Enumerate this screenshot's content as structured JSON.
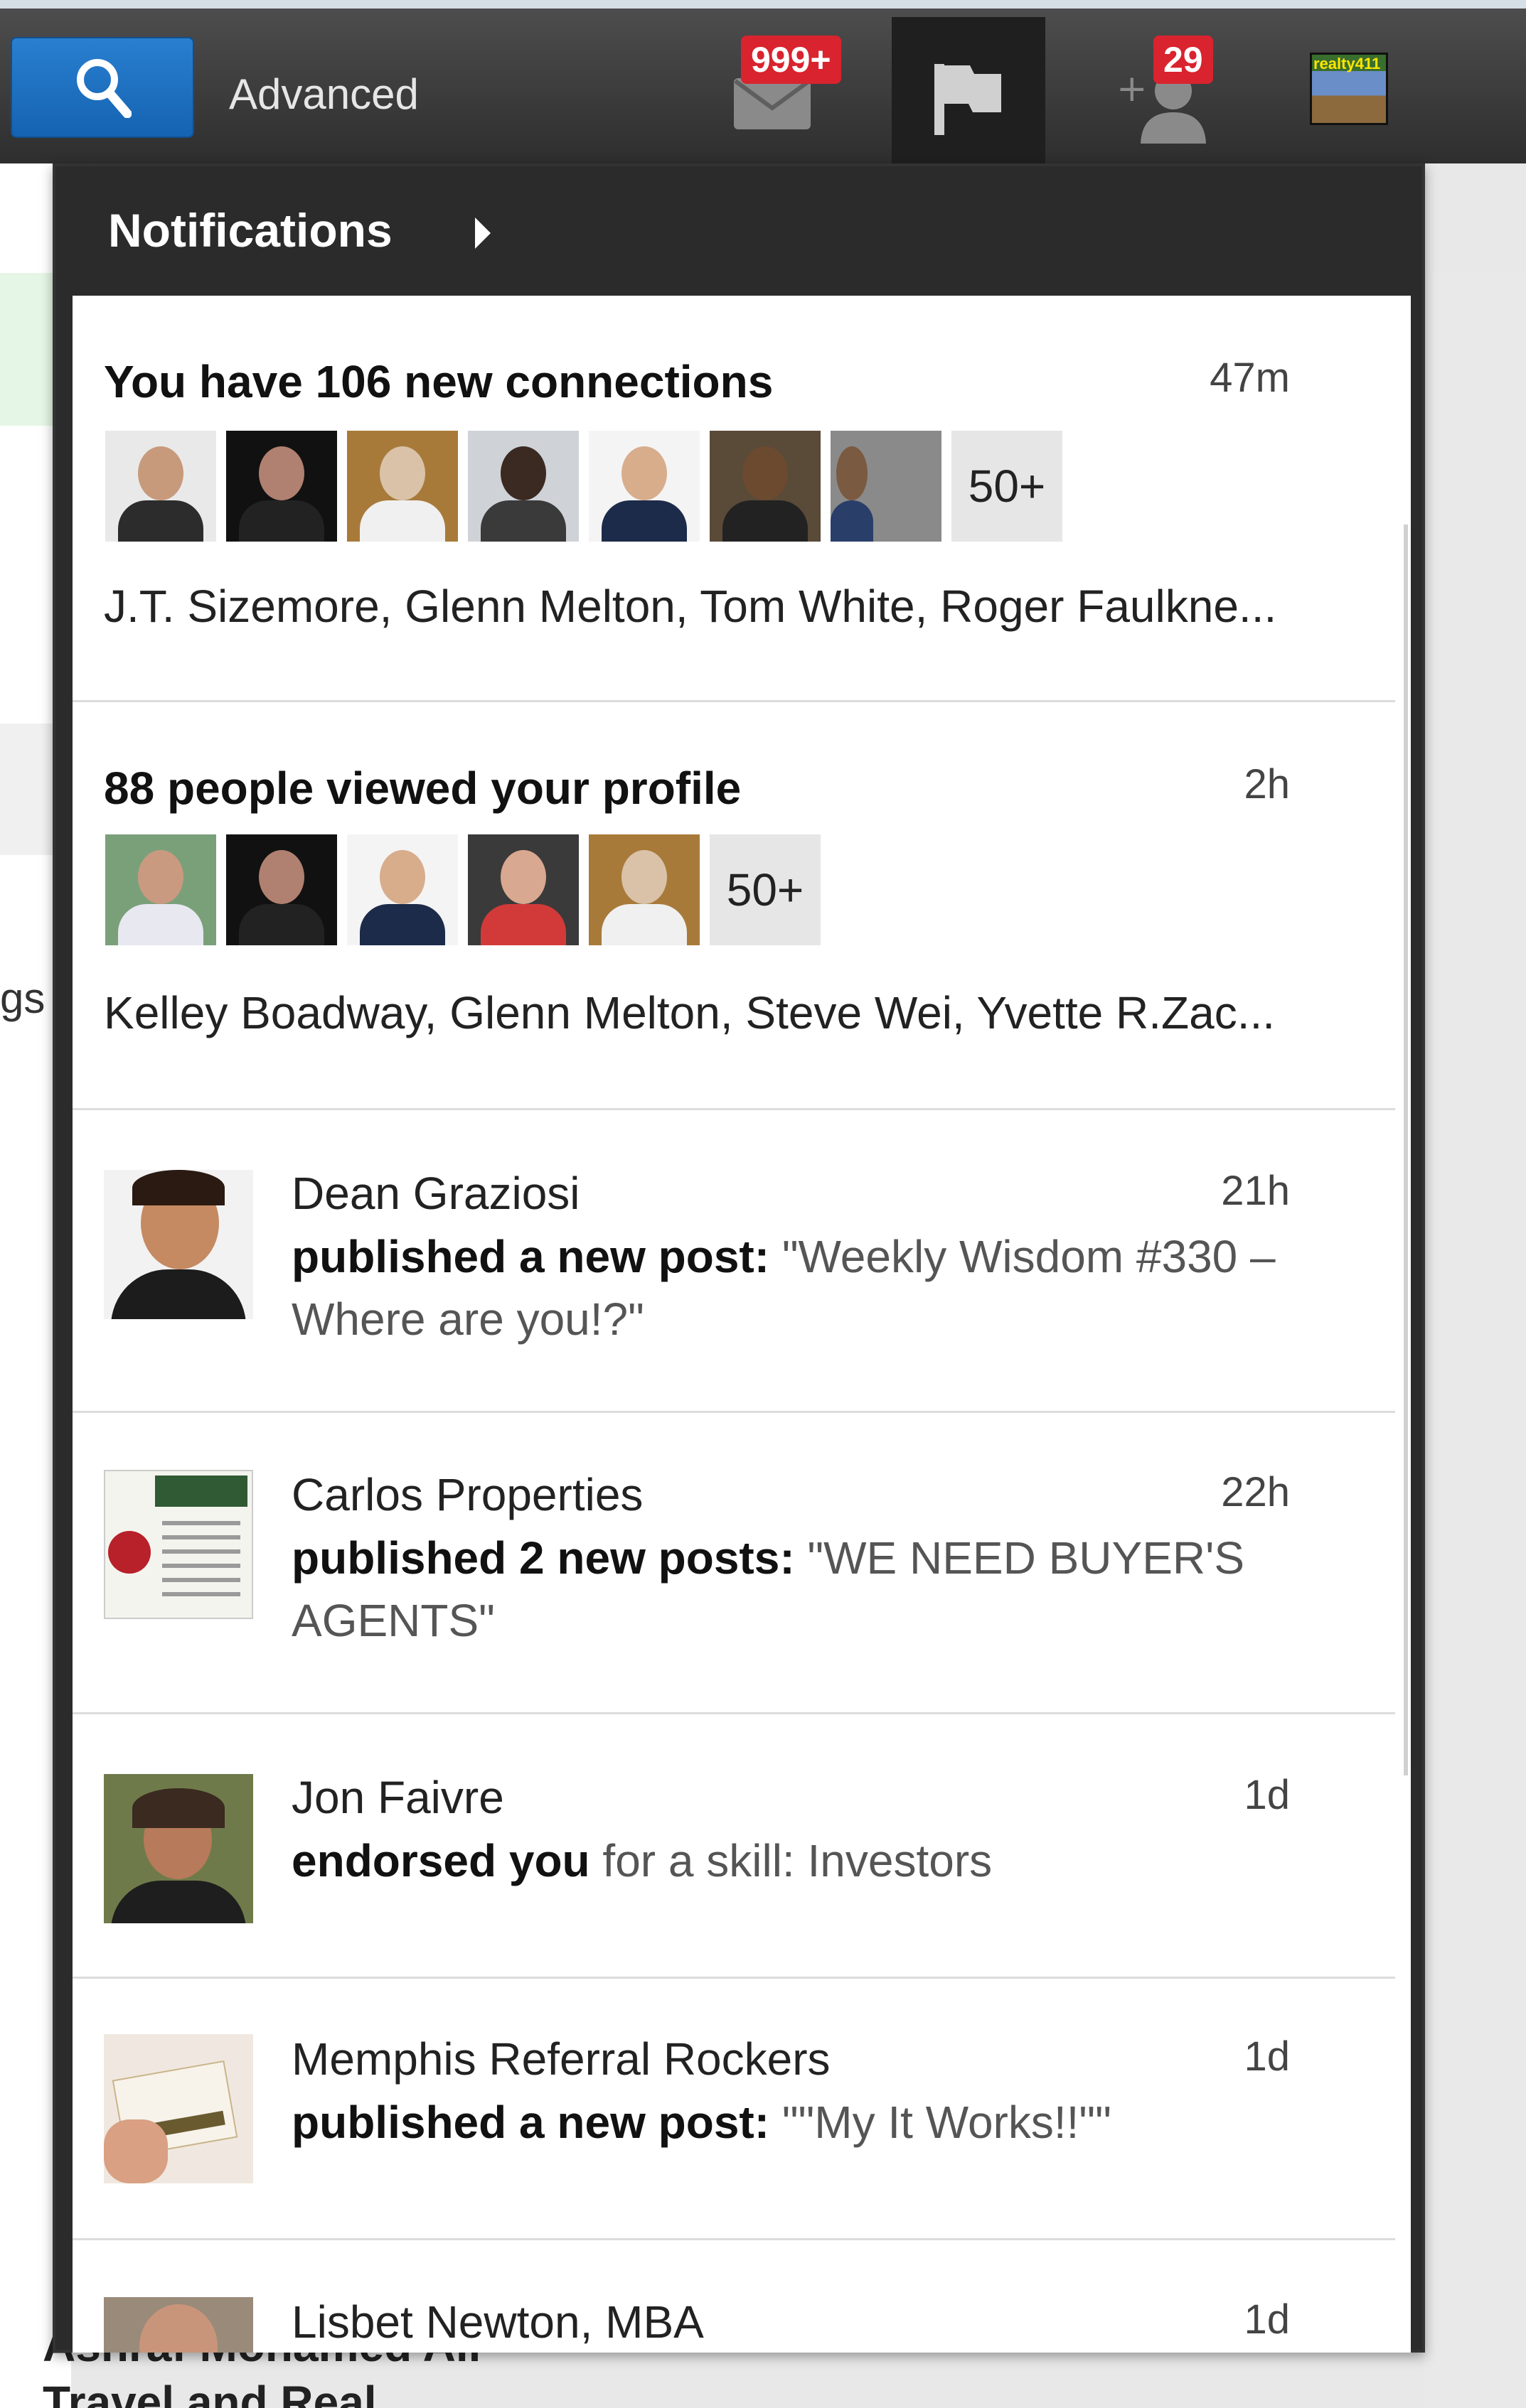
{
  "topbar": {
    "advanced_label": "Advanced",
    "messages_badge": "999+",
    "invites_badge": "29",
    "profile_logo_text": "realty411"
  },
  "background": {
    "fragment_text": "gs",
    "footer_lines": [
      "Ashraf Mohamed Ali",
      "Travel and Real"
    ]
  },
  "notifications": {
    "title": "Notifications",
    "items": [
      {
        "type": "connections",
        "headline": "You have 106 new connections",
        "time": "47m",
        "more_label": "50+",
        "names": "J.T. Sizemore, Glenn Melton, Tom White, Roger Faulkne..."
      },
      {
        "type": "profile_views",
        "headline": "88 people viewed your profile",
        "time": "2h",
        "more_label": "50+",
        "names": "Kelley Boadway, Glenn Melton, Steve Wei, Yvette R.Zac..."
      },
      {
        "type": "post",
        "actor": "Dean Graziosi",
        "action": "published a new post:",
        "detail": "\"Weekly Wisdom #330 – Where are you!?\"",
        "time": "21h"
      },
      {
        "type": "post",
        "actor": "Carlos Properties",
        "action": "published 2 new posts:",
        "detail": "\"WE NEED BUYER'S AGENTS\"",
        "time": "22h"
      },
      {
        "type": "endorsement",
        "actor": "Jon Faivre",
        "action": "endorsed you",
        "detail": "for a skill: Investors",
        "time": "1d"
      },
      {
        "type": "post",
        "actor": "Memphis Referral Rockers",
        "action": "published a new post:",
        "detail": "\"\"My It Works!!\"\"",
        "time": "1d"
      },
      {
        "type": "partial",
        "actor": "Lisbet Newton, MBA",
        "time": "1d"
      }
    ]
  },
  "colors": {
    "topbar": "#3a3a3a",
    "search_button": "#1a6fc2",
    "badge": "#d9232e",
    "panel_frame": "#2b2b2b"
  }
}
